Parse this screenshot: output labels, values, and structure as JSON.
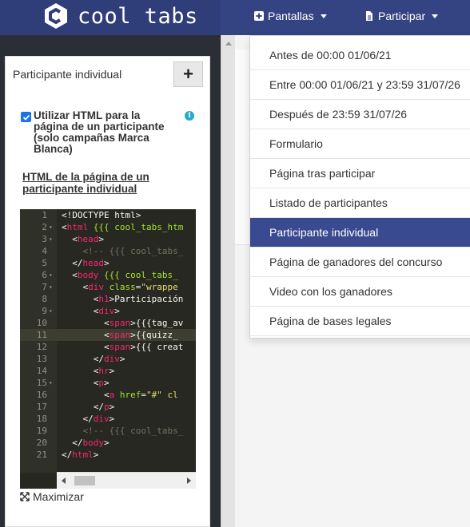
{
  "header": {
    "logo_text": "cool tabs",
    "nav": [
      {
        "label": "Pantallas",
        "icon": "plus-square-icon"
      },
      {
        "label": "Participar",
        "icon": "file-icon"
      }
    ]
  },
  "panel": {
    "title": "Participante individual",
    "add_label": "+",
    "checkbox_label": "Utilizar HTML para la página de un participante (solo campañas Marca Blanca)",
    "checkbox_checked": true,
    "info_label": "i",
    "html_link": "HTML de la página de un participante individual",
    "maximize_label": "Maximizar"
  },
  "editor": {
    "lines": [
      {
        "n": "1",
        "fold": "",
        "text": "<!DOCTYPE html>"
      },
      {
        "n": "2",
        "fold": "▾",
        "text": "<html {{{ cool_tabs_htm"
      },
      {
        "n": "3",
        "fold": "▾",
        "text": "  <head>"
      },
      {
        "n": "4",
        "fold": "",
        "text": "    <!-- {{{ cool_tabs_"
      },
      {
        "n": "5",
        "fold": "",
        "text": "  </head>"
      },
      {
        "n": "6",
        "fold": "▾",
        "text": "  <body {{{ cool_tabs_"
      },
      {
        "n": "7",
        "fold": "▾",
        "text": "    <div class=\"wrappe"
      },
      {
        "n": "8",
        "fold": "",
        "text": "      <h1>Participación"
      },
      {
        "n": "9",
        "fold": "▾",
        "text": "      <div>"
      },
      {
        "n": "10",
        "fold": "",
        "text": "        <span>{{{tag_av"
      },
      {
        "n": "11",
        "fold": "",
        "text": "        <span>{{quizz_"
      },
      {
        "n": "12",
        "fold": "",
        "text": "        <span>{{{ creat"
      },
      {
        "n": "13",
        "fold": "",
        "text": "      </div>"
      },
      {
        "n": "14",
        "fold": "",
        "text": "      <hr>"
      },
      {
        "n": "15",
        "fold": "▾",
        "text": "      <p>"
      },
      {
        "n": "16",
        "fold": "",
        "text": "        <a href=\"#\" cl"
      },
      {
        "n": "17",
        "fold": "",
        "text": "      </p>"
      },
      {
        "n": "18",
        "fold": "",
        "text": "    </div>"
      },
      {
        "n": "19",
        "fold": "",
        "text": "    <!-- {{{ cool_tabs_"
      },
      {
        "n": "20",
        "fold": "",
        "text": "  </body>"
      },
      {
        "n": "21",
        "fold": "",
        "text": "</html>"
      }
    ],
    "active_line": "11"
  },
  "dropdown": {
    "items": [
      "Antes de 00:00 01/06/21",
      "Entre 00:00 01/06/21 y 23:59 31/07/26",
      "Después de 23:59 31/07/26",
      "Formulario",
      "Página tras participar",
      "Listado de participantes",
      "Participante individual",
      "Página de ganadores del concurso",
      "Video con los ganadores",
      "Página de bases legales"
    ],
    "active_item": "Participante individual"
  },
  "colors": {
    "navbar": "#344483",
    "dropdown_active": "#3a4a91",
    "editor_bg": "#272822",
    "sidebar_dark": "#2a2f36"
  }
}
